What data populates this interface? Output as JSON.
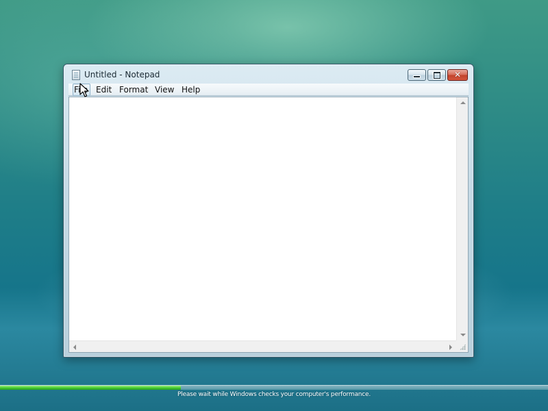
{
  "window": {
    "title": "Untitled - Notepad",
    "icon": "notepad-icon",
    "controls": {
      "minimize_icon": "minimize-icon",
      "maximize_icon": "maximize-icon",
      "close_icon": "close-icon",
      "close_glyph": "✕"
    }
  },
  "menu": {
    "items": [
      {
        "label": "File",
        "active": true
      },
      {
        "label": "Edit"
      },
      {
        "label": "Format"
      },
      {
        "label": "View"
      },
      {
        "label": "Help"
      }
    ]
  },
  "editor": {
    "text": ""
  },
  "status": {
    "message": "Please wait while Windows checks your computer's performance.",
    "progress": 0.33,
    "progress_color": "#3fc42e"
  },
  "colors": {
    "desktop_teal": "#1f7e88",
    "close_red": "#c0432c"
  }
}
